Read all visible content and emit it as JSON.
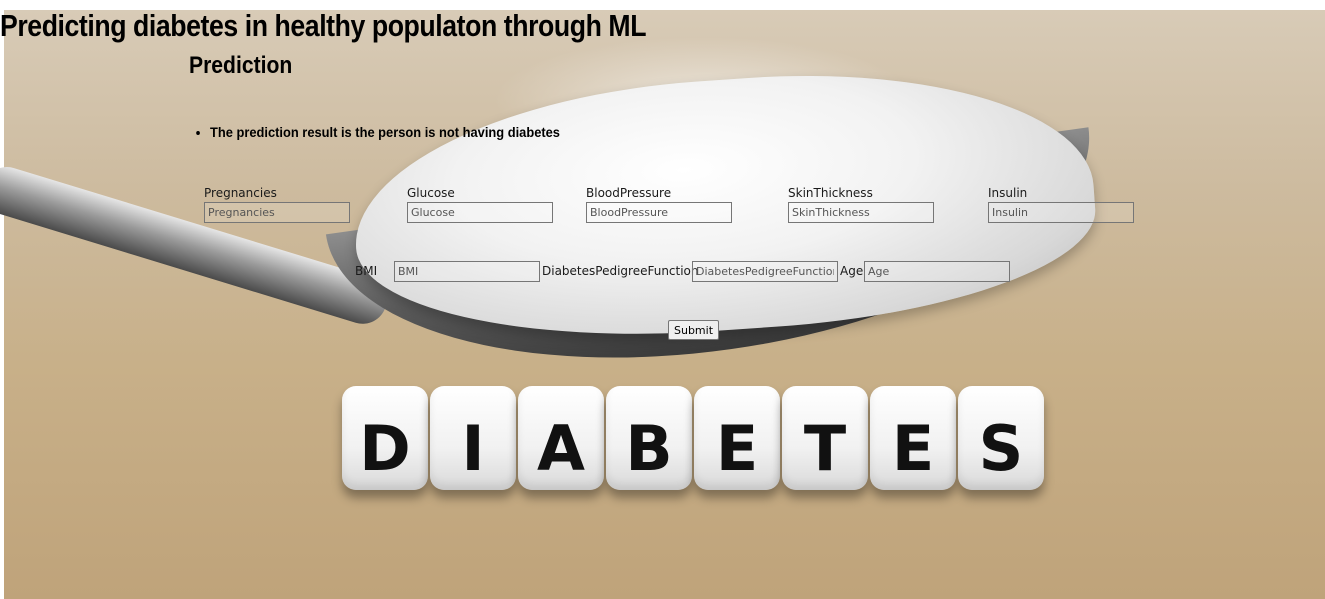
{
  "header": {
    "title": "Predicting diabetes in healthy populaton through ML",
    "subtitle": "Prediction"
  },
  "result": {
    "items": [
      "The prediction result is the person is not having diabetes"
    ]
  },
  "background": {
    "dice_letters": [
      "D",
      "I",
      "A",
      "B",
      "E",
      "T",
      "E",
      "S"
    ]
  },
  "form": {
    "fields": [
      {
        "label": "Pregnancies",
        "placeholder": "Pregnancies"
      },
      {
        "label": "Glucose",
        "placeholder": "Glucose"
      },
      {
        "label": "BloodPressure",
        "placeholder": "BloodPressure"
      },
      {
        "label": "SkinThickness",
        "placeholder": "SkinThickness"
      },
      {
        "label": "Insulin",
        "placeholder": "Insulin"
      },
      {
        "label": "BMI",
        "placeholder": "BMI"
      },
      {
        "label": "DiabetesPedigreeFunction",
        "placeholder": "DiabetesPedigreeFunction"
      },
      {
        "label": "Age",
        "placeholder": "Age"
      }
    ],
    "submit_label": "Submit"
  }
}
